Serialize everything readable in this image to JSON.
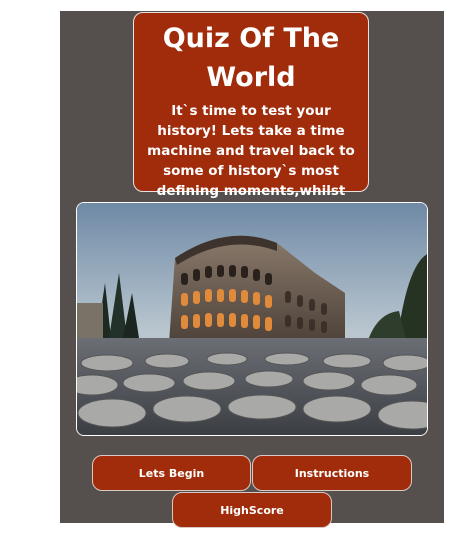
{
  "header": {
    "title": "Quiz Of The World",
    "intro": "It`s time to test your history! Lets take a time machine and travel back to some of history`s most defining moments,whilst testing your knowledge along the way."
  },
  "hero": {
    "image": "colosseum-photo"
  },
  "buttons": {
    "begin": "Lets Begin",
    "instructions": "Instructions",
    "highscore": "HighScore"
  },
  "colors": {
    "background": "#554f4e",
    "accent": "#a02c0b",
    "text": "#ffffff"
  }
}
